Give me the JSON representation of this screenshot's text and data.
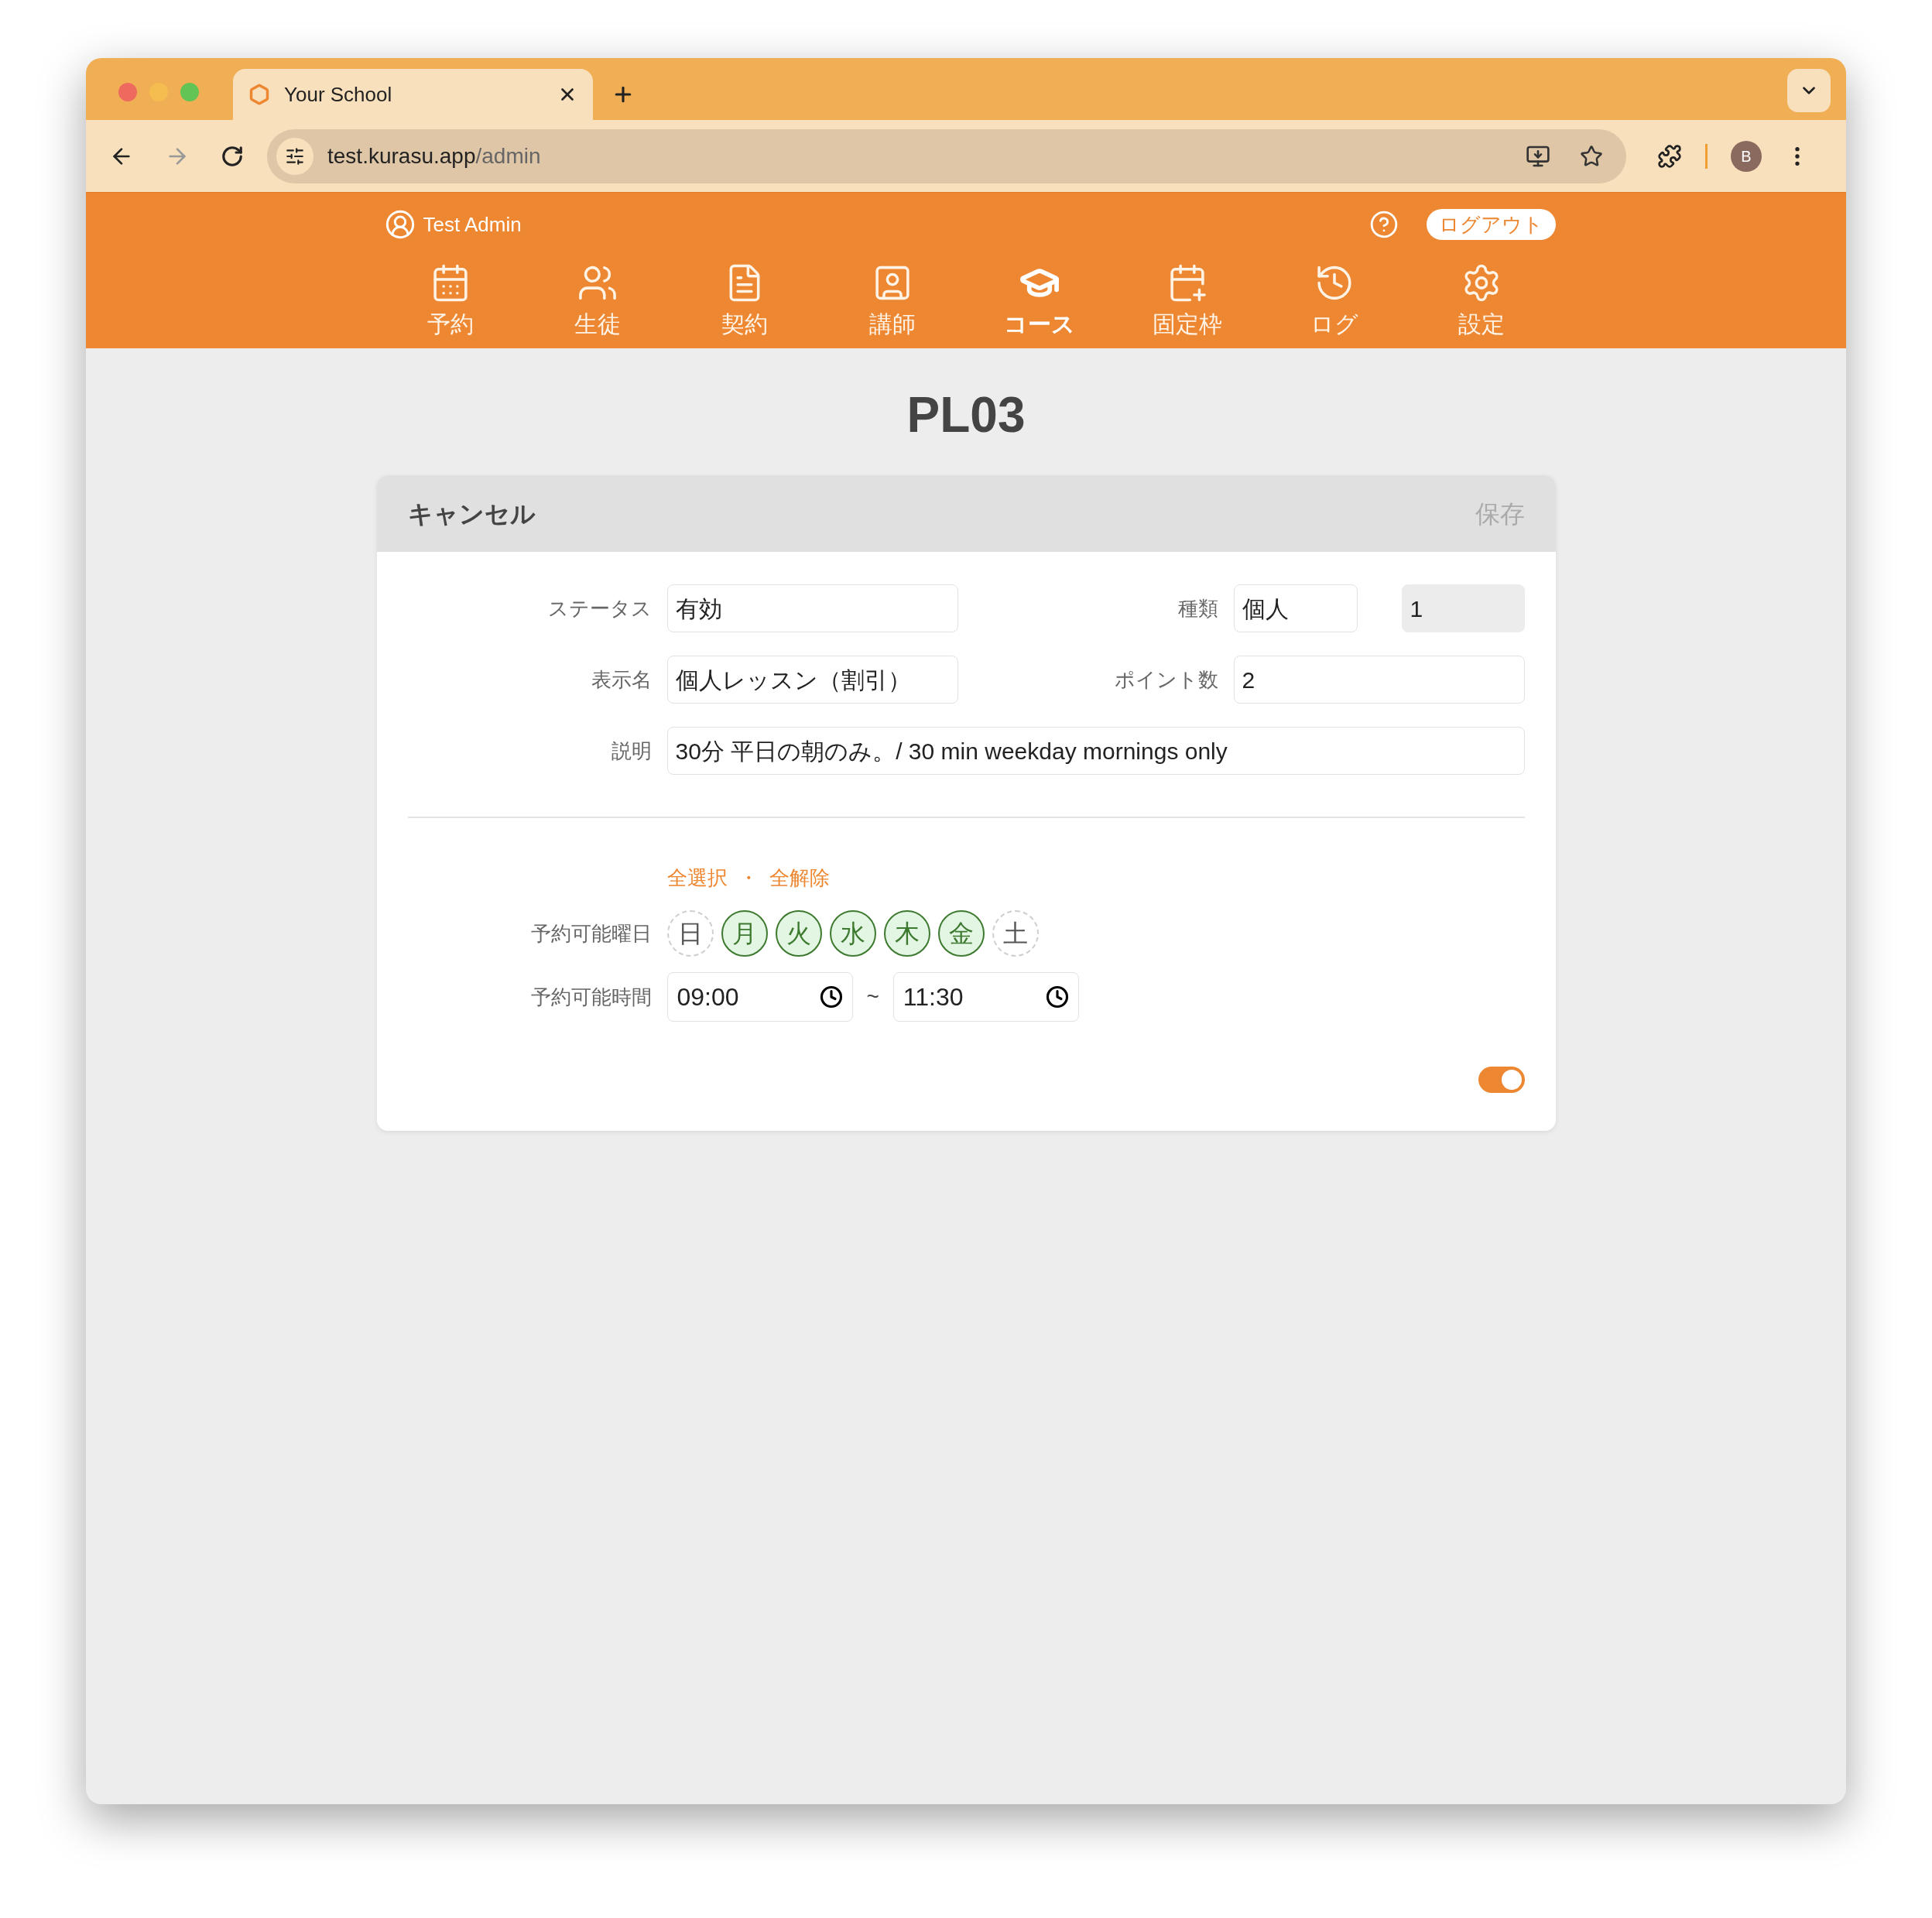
{
  "browser": {
    "tab_title": "Your School",
    "url_host": "test.kurasu.app",
    "url_path": "/admin",
    "profile": "B"
  },
  "header": {
    "user": "Test Admin",
    "logout": "ログアウト",
    "nav": [
      {
        "label": "予約",
        "selected": false
      },
      {
        "label": "生徒",
        "selected": false
      },
      {
        "label": "契約",
        "selected": false
      },
      {
        "label": "講師",
        "selected": false
      },
      {
        "label": "コース",
        "selected": true
      },
      {
        "label": "固定枠",
        "selected": false
      },
      {
        "label": "ログ",
        "selected": false
      },
      {
        "label": "設定",
        "selected": false
      }
    ]
  },
  "page_title": "PL03",
  "card": {
    "cancel": "キャンセル",
    "save": {
      "label": "保存",
      "disabled": true
    },
    "status": {
      "label": "ステータス",
      "value": "有効"
    },
    "type": {
      "label": "種類",
      "value": "個人"
    },
    "type_code": {
      "value": "1",
      "disabled": true
    },
    "display_name": {
      "label": "表示名",
      "value": "個人レッスン（割引）"
    },
    "points": {
      "label": "ポイント数",
      "value": "2"
    },
    "description": {
      "label": "説明",
      "value": "30分 平日の朝のみ。/ 30 min weekday mornings only"
    },
    "select_all": "全選択",
    "separator": "・",
    "clear_all": "全解除",
    "days_label": "予約可能曜日",
    "days": [
      {
        "label": "日",
        "selected": false
      },
      {
        "label": "月",
        "selected": true
      },
      {
        "label": "火",
        "selected": true
      },
      {
        "label": "水",
        "selected": true
      },
      {
        "label": "木",
        "selected": true
      },
      {
        "label": "金",
        "selected": true
      },
      {
        "label": "土",
        "selected": false
      }
    ],
    "time_label": "予約可能時間",
    "start": "09:00",
    "tilde": "~",
    "end": "11:30",
    "toggle": {
      "on": true
    }
  }
}
